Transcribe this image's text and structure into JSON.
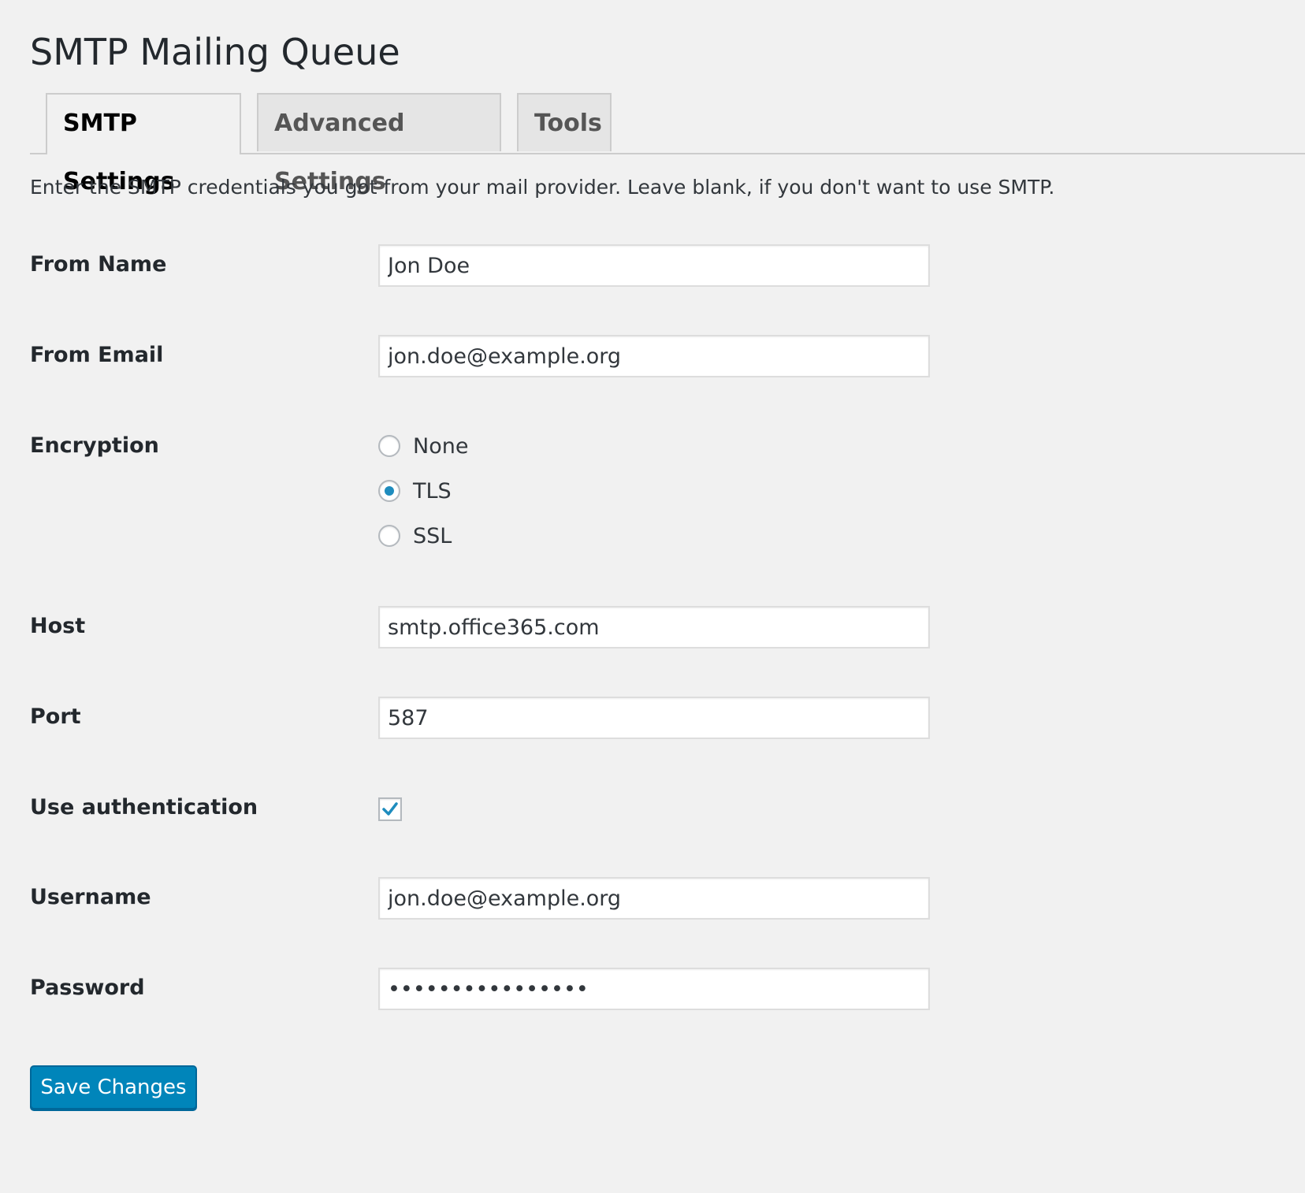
{
  "page": {
    "title": "SMTP Mailing Queue"
  },
  "tabs": [
    {
      "label": "SMTP Settings",
      "active": true
    },
    {
      "label": "Advanced Settings",
      "active": false
    },
    {
      "label": "Tools",
      "active": false
    }
  ],
  "intro": "Enter the SMTP credentials you got from your mail provider. Leave blank, if you don't want to use SMTP.",
  "form": {
    "from_name": {
      "label": "From Name",
      "value": "Jon Doe"
    },
    "from_email": {
      "label": "From Email",
      "value": "jon.doe@example.org"
    },
    "encryption": {
      "label": "Encryption",
      "options": [
        {
          "label": "None",
          "checked": false
        },
        {
          "label": "TLS",
          "checked": true
        },
        {
          "label": "SSL",
          "checked": false
        }
      ]
    },
    "host": {
      "label": "Host",
      "value": "smtp.office365.com"
    },
    "port": {
      "label": "Port",
      "value": "587"
    },
    "use_auth": {
      "label": "Use authentication",
      "checked": true
    },
    "username": {
      "label": "Username",
      "value": "jon.doe@example.org"
    },
    "password": {
      "label": "Password",
      "value": "••••••••••••••••"
    }
  },
  "save_label": "Save Changes",
  "colors": {
    "accent": "#0085ba",
    "background": "#f1f1f1",
    "radio_dot": "#1e8cbe"
  }
}
